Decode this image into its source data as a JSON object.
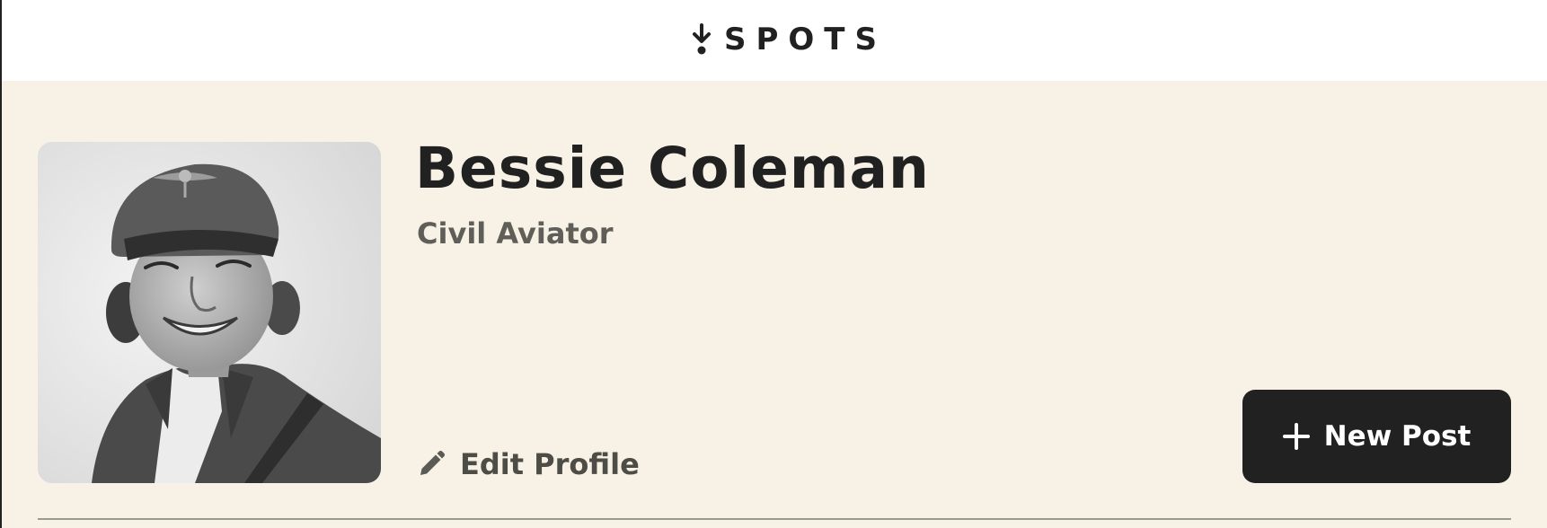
{
  "header": {
    "logo_text": "SPOTS",
    "logo_icon": "spots-logo-icon"
  },
  "profile": {
    "name": "Bessie Coleman",
    "job": "Civil Aviator",
    "avatar_alt": "Bessie Coleman",
    "edit_label": "Edit Profile",
    "edit_icon": "pencil-icon",
    "new_post_label": "New Post",
    "new_post_icon": "plus-icon"
  },
  "colors": {
    "header_bg": "#ffffff",
    "page_bg": "#f7f2e5",
    "text_primary": "#212121",
    "text_secondary": "#5f5e59",
    "button_bg": "#212121",
    "button_text": "#ffffff",
    "divider": "#9a998f"
  }
}
